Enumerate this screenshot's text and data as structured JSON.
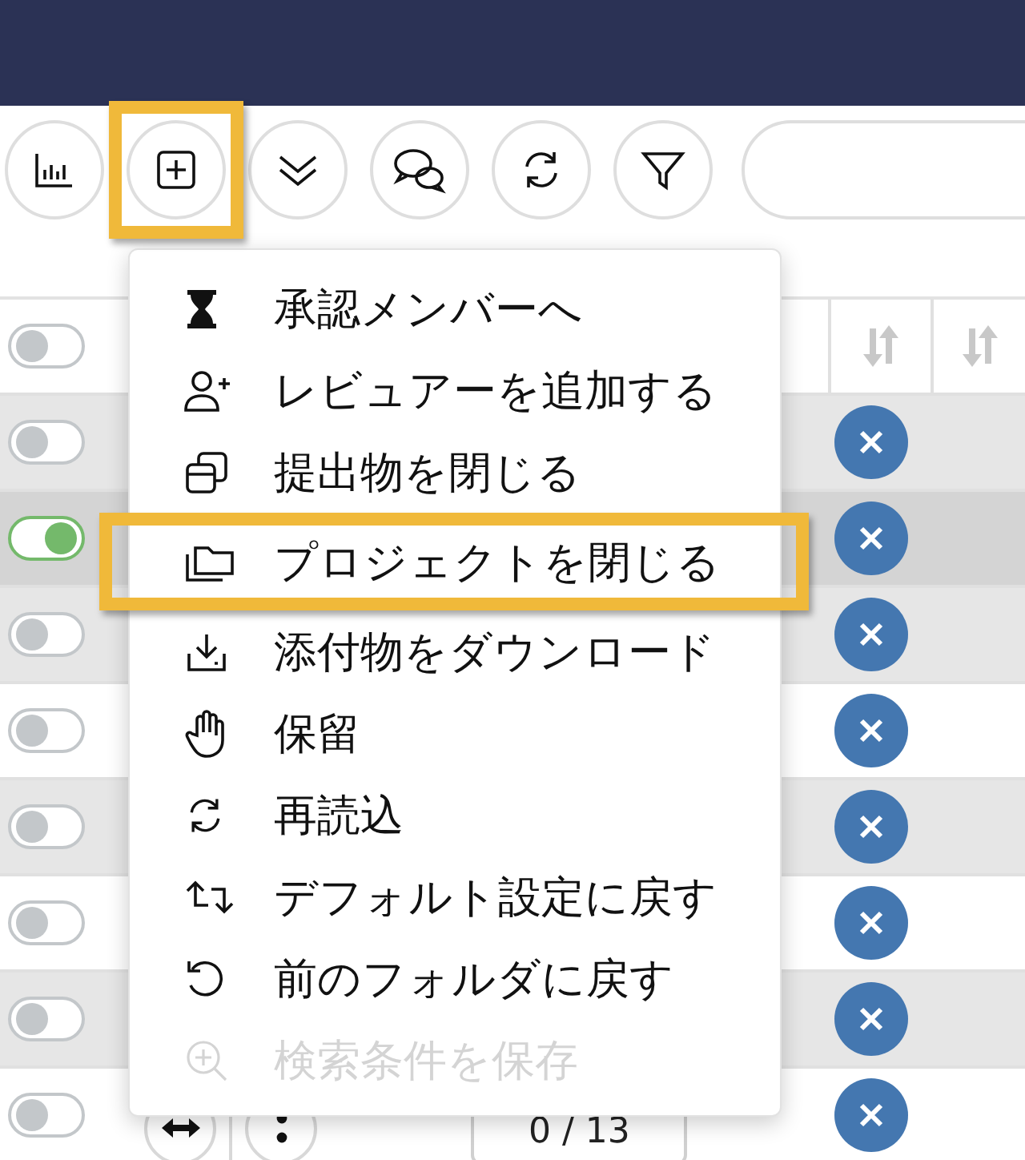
{
  "toolbar": {
    "buttons": [
      {
        "highlighted": false
      },
      {
        "highlighted": true
      },
      {
        "highlighted": false
      },
      {
        "highlighted": false
      },
      {
        "highlighted": false
      },
      {
        "highlighted": false
      }
    ]
  },
  "menu": {
    "items": [
      {
        "label": "承認メンバーへ",
        "disabled": false,
        "highlighted": false
      },
      {
        "label": "レビュアーを追加する",
        "disabled": false,
        "highlighted": false
      },
      {
        "label": "提出物を閉じる",
        "disabled": false,
        "highlighted": false
      },
      {
        "label": "プロジェクトを閉じる",
        "disabled": false,
        "highlighted": true
      },
      {
        "label": "添付物をダウンロード",
        "disabled": false,
        "highlighted": false
      },
      {
        "label": "保留",
        "disabled": false,
        "highlighted": false
      },
      {
        "label": "再読込",
        "disabled": false,
        "highlighted": false
      },
      {
        "label": "デフォルト設定に戻す",
        "disabled": false,
        "highlighted": false
      },
      {
        "label": "前のフォルダに戻す",
        "disabled": false,
        "highlighted": false
      },
      {
        "label": "検索条件を保存",
        "disabled": true,
        "highlighted": false
      }
    ]
  },
  "table": {
    "header": {
      "on": false
    },
    "rows": [
      {
        "on": false,
        "selected": false
      },
      {
        "on": true,
        "selected": true
      },
      {
        "on": false,
        "selected": false
      },
      {
        "on": false,
        "selected": false
      },
      {
        "on": false,
        "selected": false
      },
      {
        "on": false,
        "selected": false
      },
      {
        "on": false,
        "selected": false
      },
      {
        "on": false,
        "selected": false,
        "counter": "0 / 13"
      }
    ]
  }
}
